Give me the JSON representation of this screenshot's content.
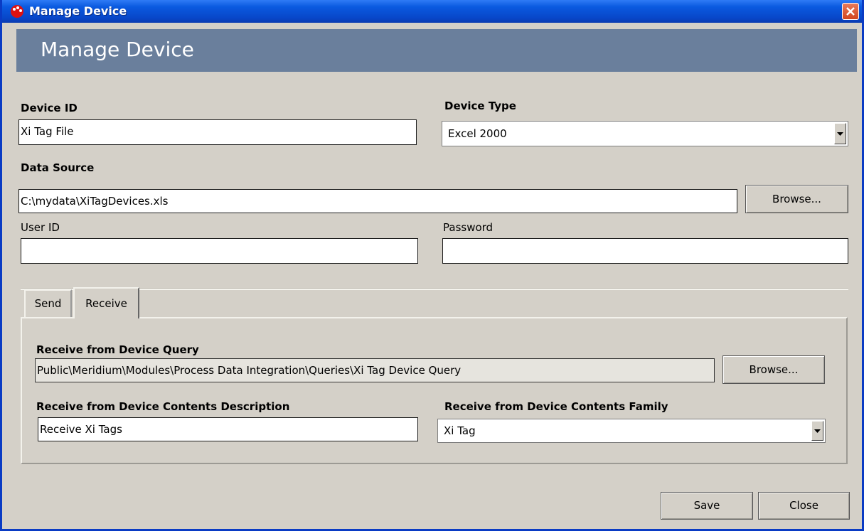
{
  "window": {
    "title": "Manage Device",
    "icon": "meridium-logo-icon",
    "close_icon": "close-icon"
  },
  "header": {
    "title": "Manage Device"
  },
  "form": {
    "device_id": {
      "label": "Device ID",
      "value": "Xi Tag File"
    },
    "device_type": {
      "label": "Device Type",
      "value": "Excel 2000"
    },
    "data_source": {
      "label": "Data Source",
      "value": "C:\\mydata\\XiTagDevices.xls",
      "browse_label": "Browse..."
    },
    "user_id": {
      "label": "User ID",
      "value": ""
    },
    "password": {
      "label": "Password",
      "value": ""
    }
  },
  "tabs": [
    {
      "label": "Send",
      "selected": false
    },
    {
      "label": "Receive",
      "selected": true
    }
  ],
  "receive": {
    "query": {
      "label": "Receive from Device Query",
      "value": "Public\\Meridium\\Modules\\Process Data Integration\\Queries\\Xi Tag Device Query",
      "browse_label": "Browse..."
    },
    "contents_description": {
      "label": "Receive from Device Contents Description",
      "value": "Receive Xi Tags"
    },
    "contents_family": {
      "label": "Receive from Device Contents Family",
      "value": "Xi Tag"
    }
  },
  "footer": {
    "save_label": "Save",
    "close_label": "Close"
  },
  "colors": {
    "title_bar": "#0a5ae0",
    "header_bar": "#6a7f9c",
    "dialog_bg": "#d4d0c8",
    "close_button": "#d2451f"
  }
}
